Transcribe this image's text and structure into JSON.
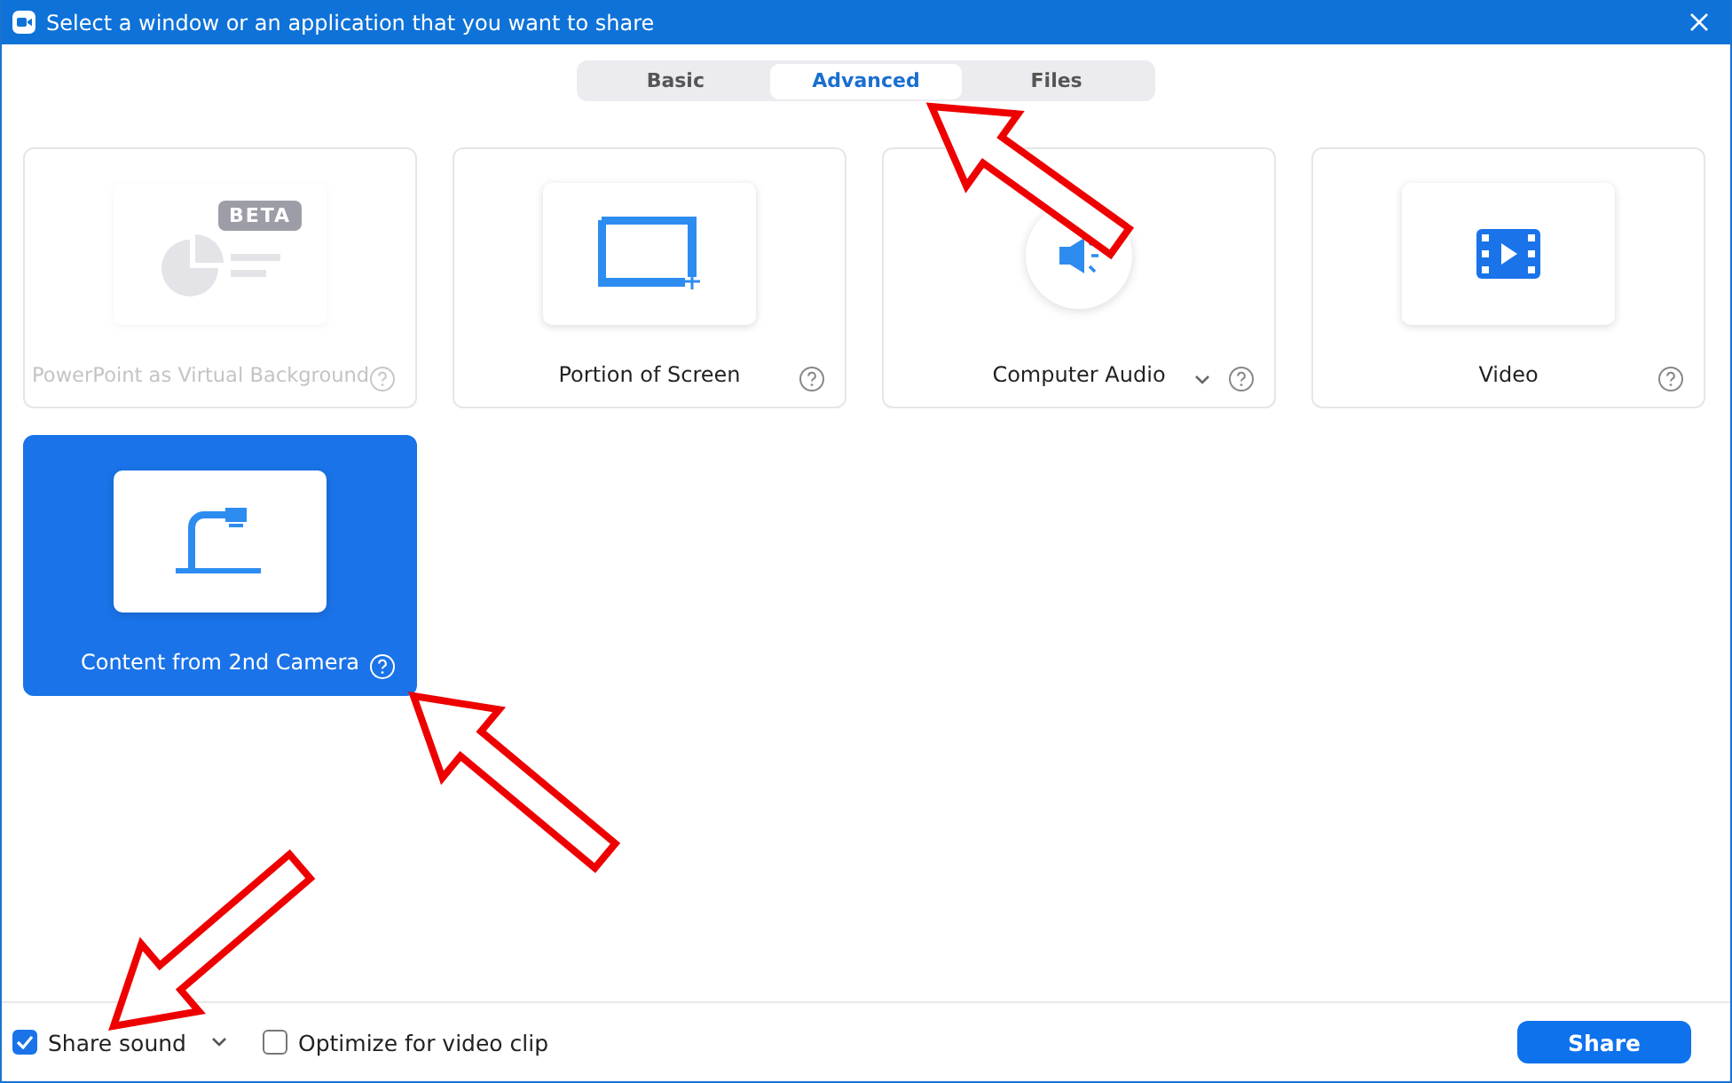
{
  "window": {
    "title": "Select a window or an application that you want to share"
  },
  "tabs": [
    {
      "label": "Basic",
      "selected": false
    },
    {
      "label": "Advanced",
      "selected": true
    },
    {
      "label": "Files",
      "selected": false
    }
  ],
  "tiles": [
    {
      "kind": "powerpoint",
      "label": "PowerPoint as Virtual Background",
      "badge": "BETA",
      "disabled": true,
      "selected": false,
      "has_menu": false
    },
    {
      "kind": "portion",
      "label": "Portion of Screen",
      "disabled": false,
      "selected": false,
      "has_menu": false
    },
    {
      "kind": "audio",
      "label": "Computer Audio",
      "disabled": false,
      "selected": false,
      "has_menu": true
    },
    {
      "kind": "video",
      "label": "Video",
      "disabled": false,
      "selected": false,
      "has_menu": false
    },
    {
      "kind": "camera",
      "label": "Content from 2nd Camera",
      "disabled": false,
      "selected": true,
      "has_menu": false
    }
  ],
  "footer": {
    "options": [
      {
        "label": "Share sound",
        "checked": true,
        "has_menu": true
      },
      {
        "label": "Optimize for video clip",
        "checked": false,
        "has_menu": false
      }
    ],
    "button": "Share"
  }
}
